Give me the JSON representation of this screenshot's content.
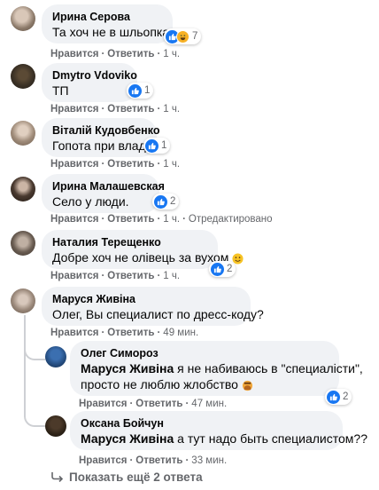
{
  "comments": [
    {
      "name": "Ирина Серова",
      "text": "Та хоч не в шльопках",
      "like": "Нравится",
      "reply": "Ответить",
      "time": "1 ч.",
      "reactions": "7"
    },
    {
      "name": "Dmytro Vdoviko",
      "text": "ТП",
      "like": "Нравится",
      "reply": "Ответить",
      "time": "1 ч.",
      "reactions": "1"
    },
    {
      "name": "Віталій Кудовбенко",
      "text": "Гопота при владі",
      "like": "Нравится",
      "reply": "Ответить",
      "time": "1 ч.",
      "reactions": "1"
    },
    {
      "name": "Ирина Малашевская",
      "text": "Село у люди.",
      "like": "Нравится",
      "reply": "Ответить",
      "time": "1 ч.",
      "edited": "Отредактировано",
      "reactions": "2"
    },
    {
      "name": "Наталия Терещенко",
      "text": "Добре хоч не олівець за вухом",
      "like": "Нравится",
      "reply": "Ответить",
      "time": "1 ч.",
      "reactions": "2"
    },
    {
      "name": "Маруся Живіна",
      "text": "Олег, Вы специалист по дресс-коду?",
      "like": "Нравится",
      "reply": "Ответить",
      "time": "49 мин."
    }
  ],
  "replies": [
    {
      "name": "Олег Симороз",
      "mention": "Маруся Живіна",
      "text1": " я не набиваюсь в \"специалісти\",",
      "text2": "просто не люблю жлобство",
      "like": "Нравится",
      "reply": "Ответить",
      "time": "47 мин.",
      "reactions": "2"
    },
    {
      "name": "Оксана Бойчун",
      "mention": "Маруся Живіна",
      "text1": " а тут надо быть специалистом??",
      "like": "Нравится",
      "reply": "Ответить",
      "time": "33 мин."
    }
  ],
  "show_more": "Показать ещё 2 ответа",
  "colors": {
    "bubble": "#f0f2f5",
    "like": "#1877f2",
    "muted": "#65676b",
    "haha": "#f7b125"
  },
  "icons": [
    "like-icon",
    "haha-icon",
    "reply-arrow-icon"
  ]
}
